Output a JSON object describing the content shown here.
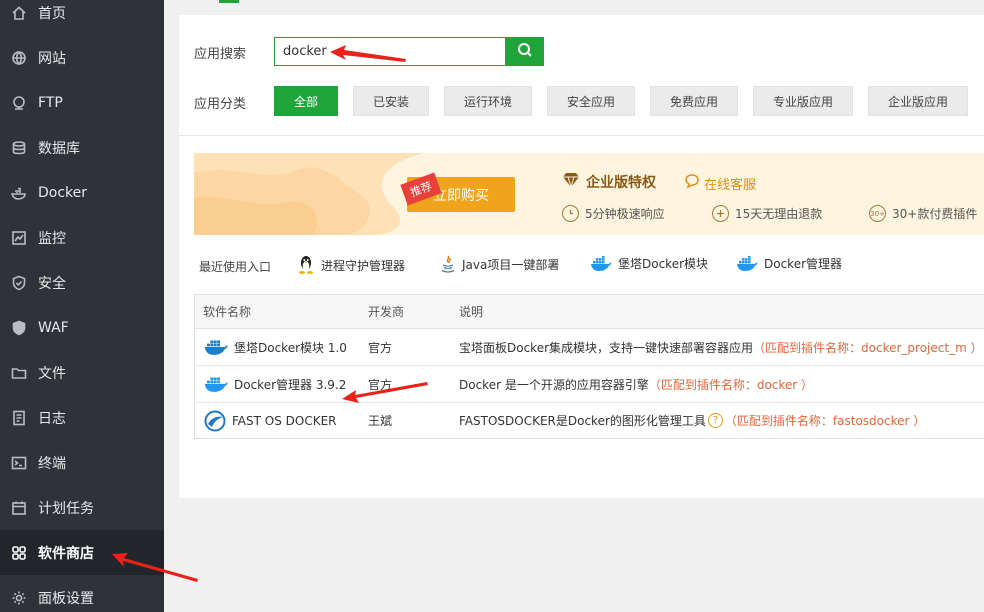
{
  "sidebar": {
    "items": [
      {
        "label": "首页",
        "icon": "home-icon"
      },
      {
        "label": "网站",
        "icon": "globe-icon"
      },
      {
        "label": "FTP",
        "icon": "ftp-icon"
      },
      {
        "label": "数据库",
        "icon": "database-icon"
      },
      {
        "label": "Docker",
        "icon": "docker-icon"
      },
      {
        "label": "监控",
        "icon": "monitor-icon"
      },
      {
        "label": "安全",
        "icon": "shield-icon"
      },
      {
        "label": "WAF",
        "icon": "waf-shield-icon"
      },
      {
        "label": "文件",
        "icon": "folder-icon"
      },
      {
        "label": "日志",
        "icon": "log-icon"
      },
      {
        "label": "终端",
        "icon": "terminal-icon"
      },
      {
        "label": "计划任务",
        "icon": "calendar-icon"
      },
      {
        "label": "软件商店",
        "icon": "apps-grid-icon",
        "active": true
      },
      {
        "label": "面板设置",
        "icon": "settings-icon"
      }
    ]
  },
  "search": {
    "label": "应用搜索",
    "value": "docker"
  },
  "categories": {
    "label": "应用分类",
    "items": [
      "全部",
      "已安装",
      "运行环境",
      "安全应用",
      "免费应用",
      "专业版应用",
      "企业版应用"
    ]
  },
  "banner": {
    "badge": "推荐",
    "buy_label": "立即购买",
    "enterprise_title": "企业版特权",
    "service_label": "在线客服",
    "features": [
      {
        "label": "5分钟极速响应",
        "icon_text": ""
      },
      {
        "label": "15天无理由退款",
        "icon_text": ""
      },
      {
        "label": "30+款付费插件",
        "icon_text": "30+"
      }
    ]
  },
  "recent": {
    "label": "最近使用入口",
    "items": [
      {
        "label": "进程守护管理器",
        "icon": "linux-penguin-icon"
      },
      {
        "label": "Java项目一键部署",
        "icon": "java-icon"
      },
      {
        "label": "堡塔Docker模块",
        "icon": "docker-whale-icon"
      },
      {
        "label": "Docker管理器",
        "icon": "docker-whale-icon"
      }
    ]
  },
  "table": {
    "headers": [
      "软件名称",
      "开发商",
      "说明"
    ],
    "rows": [
      {
        "name": "堡塔Docker模块 1.0",
        "vendor": "官方",
        "desc": "宝塔面板Docker集成模块，支持一键快速部署容器应用",
        "match": "（匹配到插件名称：docker_project_m ）",
        "icon": "docker-whale-icon"
      },
      {
        "name": "Docker管理器 3.9.2",
        "vendor": "官方",
        "desc": "Docker 是一个开源的应用容器引擎",
        "match": "（匹配到插件名称：docker ）",
        "icon": "docker-whale-icon"
      },
      {
        "name": "FAST OS DOCKER",
        "vendor": "王斌",
        "desc": "FASTOSDOCKER是Docker的图形化管理工具",
        "match": "（匹配到插件名称：fastosdocker ）",
        "icon": "fastos-icon",
        "help": "?"
      }
    ]
  },
  "colors": {
    "accent": "#20a53a",
    "sidebar_bg": "#2f3339",
    "annotation_arrow": "#e8231b",
    "match_text": "#e8643a"
  }
}
